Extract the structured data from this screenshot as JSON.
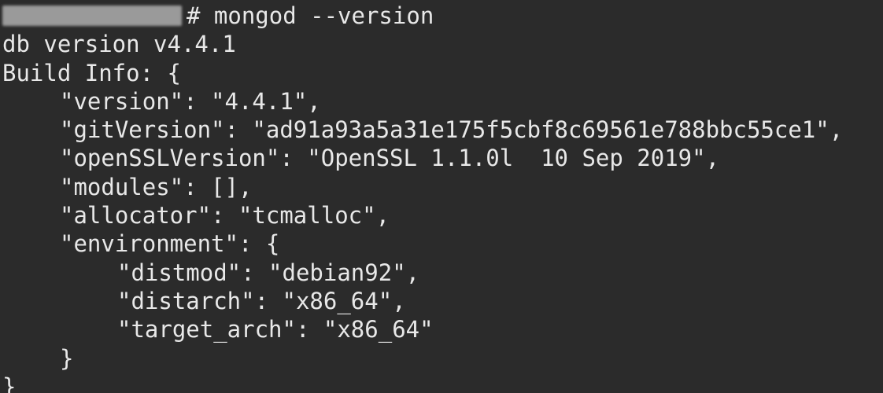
{
  "terminal": {
    "prompt_symbol": "# ",
    "command": "mongod --version",
    "output": [
      {
        "indent": 0,
        "text": "db version v4.4.1"
      },
      {
        "indent": 0,
        "text": "Build Info: {"
      },
      {
        "indent": 1,
        "text": "\"version\": \"4.4.1\","
      },
      {
        "indent": 1,
        "text": "\"gitVersion\": \"ad91a93a5a31e175f5cbf8c69561e788bbc55ce1\","
      },
      {
        "indent": 1,
        "text": "\"openSSLVersion\": \"OpenSSL 1.1.0l  10 Sep 2019\","
      },
      {
        "indent": 1,
        "text": "\"modules\": [],"
      },
      {
        "indent": 1,
        "text": "\"allocator\": \"tcmalloc\","
      },
      {
        "indent": 1,
        "text": "\"environment\": {"
      },
      {
        "indent": 2,
        "text": "\"distmod\": \"debian92\","
      },
      {
        "indent": 2,
        "text": "\"distarch\": \"x86_64\","
      },
      {
        "indent": 2,
        "text": "\"target_arch\": \"x86_64\""
      },
      {
        "indent": 1,
        "text": "}"
      },
      {
        "indent": 0,
        "text": "}"
      }
    ],
    "colors": {
      "background": "#2b2b2b",
      "foreground": "#e8e8e8",
      "redaction": "#9a9a9a"
    }
  }
}
